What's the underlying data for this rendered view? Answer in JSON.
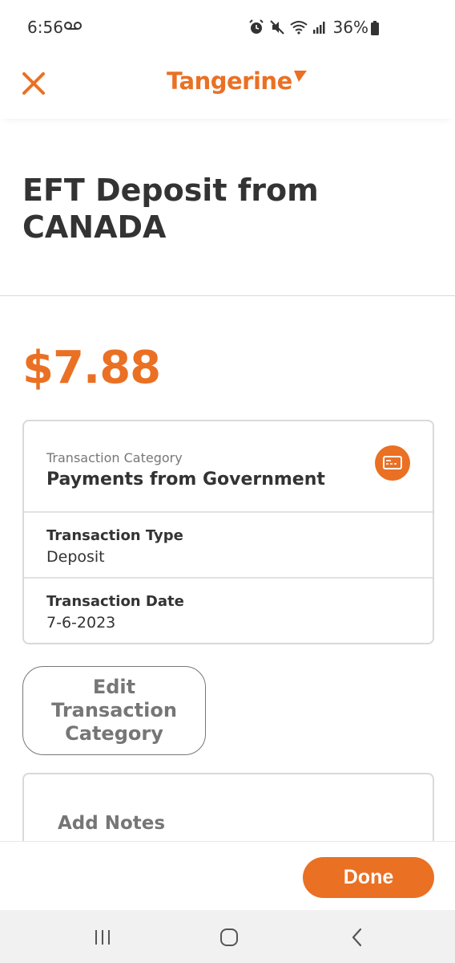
{
  "status_bar": {
    "time": "6:56",
    "battery": "36%"
  },
  "header": {
    "brand": "Tangerine",
    "close_icon": "close-icon"
  },
  "transaction": {
    "title": "EFT Deposit from CANADA",
    "amount": "$7.88",
    "category": {
      "label": "Transaction Category",
      "value": "Payments from Government",
      "icon": "cheque-icon"
    },
    "type": {
      "label": "Transaction Type",
      "value": "Deposit"
    },
    "date": {
      "label": "Transaction Date",
      "value": "7-6-2023"
    }
  },
  "actions": {
    "edit_category_label": "Edit Transaction Category",
    "notes_title": "Add Notes",
    "done_label": "Done"
  },
  "colors": {
    "accent": "#ea7024",
    "text": "#333333",
    "muted": "#767676"
  }
}
